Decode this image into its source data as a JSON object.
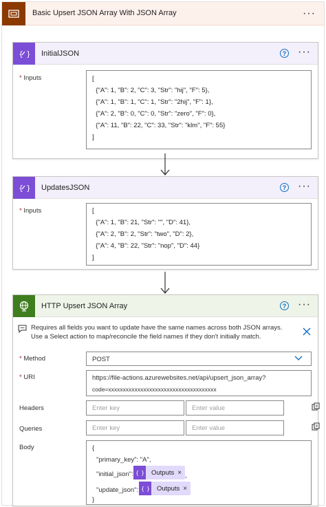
{
  "scope": {
    "title": "Basic Upsert JSON Array With JSON Array",
    "more": "···"
  },
  "initial": {
    "title": "InitialJSON",
    "help": "?",
    "more": "···",
    "inputs_label": "Inputs",
    "lines": [
      "[",
      "  {\"A\": 1, \"B\": 2, \"C\": 3, \"Str\": \"hij\", \"F\": 5},",
      "  {\"A\": 1, \"B\": 1, \"C\": 1, \"Str\": \"2hij\", \"F\": 1},",
      "  {\"A\": 2, \"B\": 0, \"C\": 0, \"Str\": \"zero\", \"F\": 0},",
      "  {\"A\": 11, \"B\": 22, \"C\": 33, \"Str\": \"klm\", \"F\": 55}",
      "]"
    ]
  },
  "updates": {
    "title": "UpdatesJSON",
    "help": "?",
    "more": "···",
    "inputs_label": "Inputs",
    "lines": [
      "[",
      "  {\"A\": 1, \"B\": 21, \"Str\": \"\", \"D\": 41},",
      "  {\"A\": 2, \"B\": 2, \"Str\": \"two\", \"D\": 2},",
      "  {\"A\": 4, \"B\": 22, \"Str\": \"nop\", \"D\": 44}",
      "]"
    ]
  },
  "http": {
    "title": "HTTP Upsert JSON Array",
    "help": "?",
    "more": "···",
    "note": "Requires all fields you want to update have the same names across both JSON arrays. Use a Select action to map/reconcile the field names if they don't initially match.",
    "method_label": "Method",
    "method_value": "POST",
    "uri_label": "URI",
    "uri_line1": "https://file-actions.azurewebsites.net/api/upsert_json_array?",
    "uri_line2": "code=xxxxxxxxxxxxxxxxxxxxxxxxxxxxxxxxxxxxx",
    "headers_label": "Headers",
    "queries_label": "Queries",
    "key_placeholder": "Enter key",
    "value_placeholder": "Enter value",
    "body_label": "Body",
    "body_open": "{",
    "body_pk": "\"primary_key\": \"A\",",
    "body_initial": "\"initial_json\":",
    "body_initial_after": ",",
    "body_update": "\"update_json\":",
    "body_close": "}",
    "token_label": "Outputs",
    "token_close": "×"
  },
  "required_mark": "*",
  "colors": {
    "scope_accent": "#8c3900",
    "compose_accent": "#7c4dd6",
    "http_accent": "#3f7d1f",
    "link_blue": "#0b6ec5"
  }
}
